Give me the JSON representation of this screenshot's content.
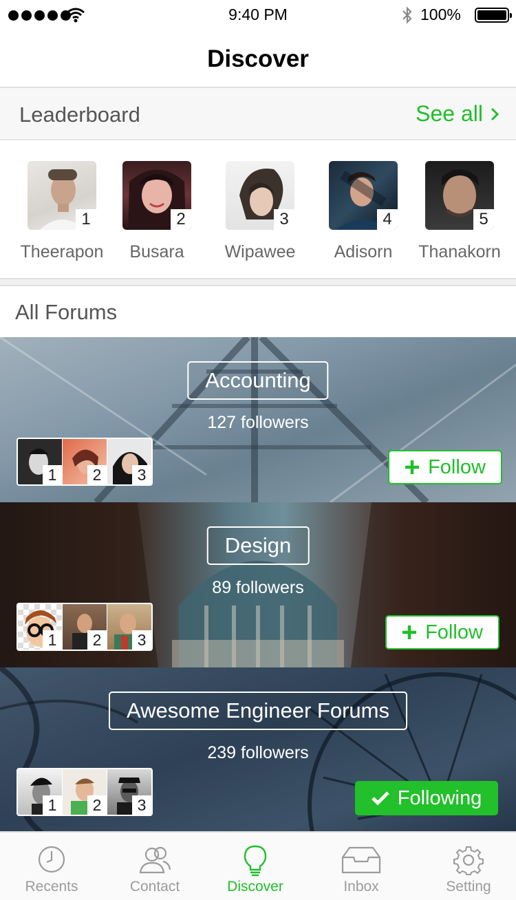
{
  "status_bar": {
    "time": "9:40 PM",
    "battery": "100%"
  },
  "nav": {
    "title": "Discover"
  },
  "leaderboard": {
    "title": "Leaderboard",
    "see_all": "See all",
    "users": [
      {
        "name": "Theerapon",
        "rank": "1"
      },
      {
        "name": "Busara",
        "rank": "2"
      },
      {
        "name": "Wipawee",
        "rank": "3"
      },
      {
        "name": "Adisorn",
        "rank": "4"
      },
      {
        "name": "Thanakorn",
        "rank": "5"
      }
    ]
  },
  "forums": {
    "title": "All Forums",
    "items": [
      {
        "name": "Accounting",
        "followers": "127 followers",
        "ranks": [
          "1",
          "2",
          "3"
        ],
        "button": "Follow",
        "following": false
      },
      {
        "name": "Design",
        "followers": "89 followers",
        "ranks": [
          "1",
          "2",
          "3"
        ],
        "button": "Follow",
        "following": false
      },
      {
        "name": "Awesome Engineer Forums",
        "followers": "239 followers",
        "ranks": [
          "1",
          "2",
          "3"
        ],
        "button": "Following",
        "following": true
      }
    ]
  },
  "tabs": [
    {
      "label": "Recents",
      "icon": "clock-icon"
    },
    {
      "label": "Contact",
      "icon": "contacts-icon"
    },
    {
      "label": "Discover",
      "icon": "lightbulb-icon"
    },
    {
      "label": "Inbox",
      "icon": "inbox-icon"
    },
    {
      "label": "Setting",
      "icon": "gear-icon"
    }
  ],
  "colors": {
    "accent": "#1fbf2a",
    "accent_fill": "#22c02a",
    "header_bg": "#f7f7f7"
  }
}
